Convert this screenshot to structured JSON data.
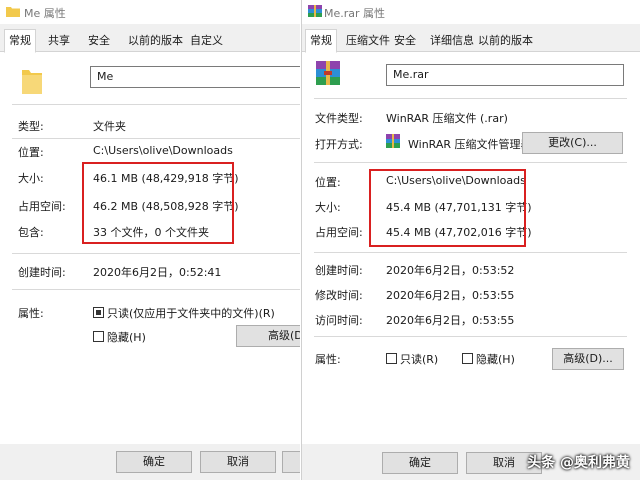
{
  "left": {
    "title": "Me 属性",
    "tabs": [
      "常规",
      "共享",
      "安全",
      "以前的版本",
      "自定义"
    ],
    "name": "Me",
    "rows": [
      {
        "label": "类型:",
        "value": "文件夹"
      },
      {
        "label": "位置:",
        "value": "C:\\Users\\olive\\Downloads"
      },
      {
        "label": "大小:",
        "value": "46.1 MB (48,429,918 字节)"
      },
      {
        "label": "占用空间:",
        "value": "46.2 MB (48,508,928 字节)"
      },
      {
        "label": "包含:",
        "value": "33 个文件，0 个文件夹"
      },
      {
        "label": "创建时间:",
        "value": "2020年6月2日，0:52:41"
      }
    ],
    "attributes": {
      "label": "属性:",
      "readonly": "只读(仅应用于文件夹中的文件)(R)",
      "hidden": "隐藏(H)",
      "advanced": "高级(D"
    },
    "buttons": {
      "ok": "确定",
      "cancel": "取消"
    }
  },
  "right": {
    "title": "Me.rar 属性",
    "tabs": [
      "常规",
      "压缩文件",
      "安全",
      "详细信息",
      "以前的版本"
    ],
    "name": "Me.rar",
    "type_label": "文件类型:",
    "type_value": "WinRAR 压缩文件 (.rar)",
    "open_label": "打开方式:",
    "open_value": "WinRAR 压缩文件管理器",
    "change_button": "更改(C)...",
    "rows": [
      {
        "label": "位置:",
        "value": "C:\\Users\\olive\\Downloads"
      },
      {
        "label": "大小:",
        "value": "45.4 MB (47,701,131 字节)"
      },
      {
        "label": "占用空间:",
        "value": "45.4 MB (47,702,016 字节)"
      }
    ],
    "times": [
      {
        "label": "创建时间:",
        "value": "2020年6月2日，0:53:52"
      },
      {
        "label": "修改时间:",
        "value": "2020年6月2日，0:53:55"
      },
      {
        "label": "访问时间:",
        "value": "2020年6月2日，0:53:55"
      }
    ],
    "attributes": {
      "label": "属性:",
      "readonly": "只读(R)",
      "hidden": "隐藏(H)",
      "advanced": "高级(D)..."
    },
    "buttons": {
      "ok": "确定",
      "cancel": "取消"
    }
  },
  "watermark": "头条 @奥利弗黄",
  "colors": {
    "highlight": "#d92020",
    "folder": "#f2c94c"
  }
}
